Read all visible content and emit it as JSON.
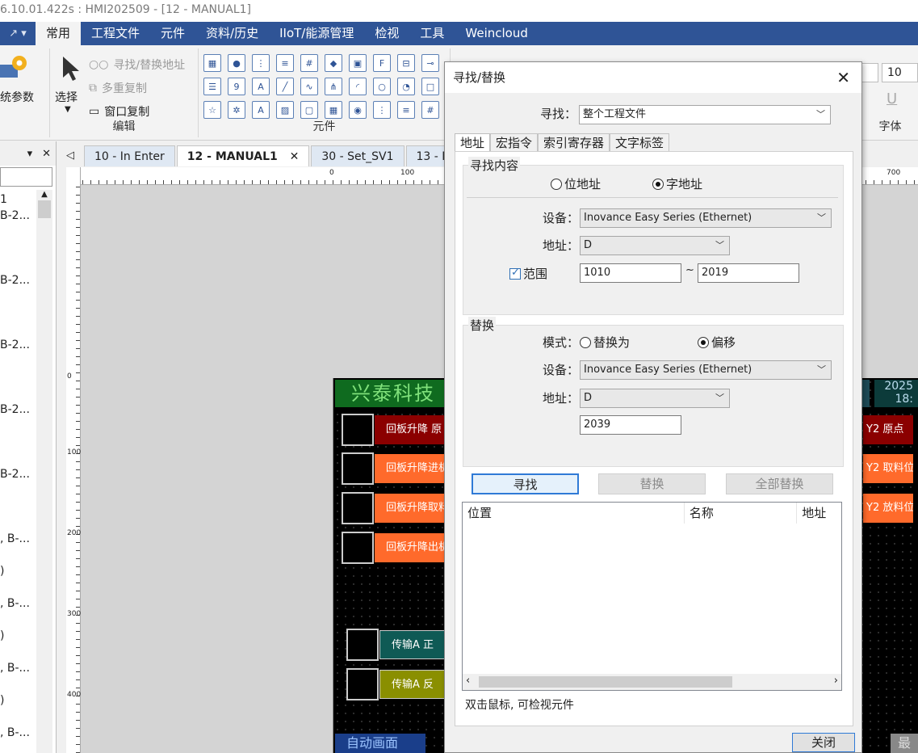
{
  "window": {
    "title": "6.10.01.422s : HMI202509 - [12 - MANUAL1]"
  },
  "ribbon": {
    "quick_access": "↗ ▾",
    "tabs": [
      "常用",
      "工程文件",
      "元件",
      "资料/历史",
      "IIoT/能源管理",
      "检视",
      "工具",
      "Weincloud"
    ],
    "active_tab": 0,
    "system_params_label": "统参数",
    "select_label": "选择",
    "edit_items": [
      "寻找/替换地址",
      "多重复制",
      "窗口复制"
    ],
    "edit_group_label": "编辑",
    "element_group_label": "元件",
    "font_size": "10",
    "font_group_label": "字体"
  },
  "left_panel": {
    "header_icons": [
      "▾",
      "✕"
    ],
    "items": [
      "1",
      "B-2...",
      "B-2...",
      "B-2...",
      "B-2...",
      "B-2...",
      ", B-...",
      ")",
      ", B-...",
      ")",
      ", B-...",
      ")",
      ", B-..."
    ]
  },
  "doc_tabs": {
    "items": [
      {
        "label": "10 - In Enter",
        "active": false
      },
      {
        "label": "12 - MANUAL1",
        "active": true
      },
      {
        "label": "30 - Set_SV1",
        "active": false
      },
      {
        "label": "13 - M",
        "active": false
      }
    ],
    "close_glyph": "✕"
  },
  "rulers": {
    "h_labels": [
      "0",
      "100",
      "700"
    ],
    "v_labels": [
      "0",
      "100",
      "200",
      "300",
      "400"
    ]
  },
  "hmi": {
    "title": "兴泰科技",
    "clock_lines": [
      "2025",
      "18:"
    ],
    "left_buttons": [
      {
        "label": "回板升降 原",
        "color": "#8b0000"
      },
      {
        "label": "回板升降进机",
        "color": "#ff6a2b"
      },
      {
        "label": "回板升降取料",
        "color": "#ff6a2b"
      },
      {
        "label": "回板升降出机",
        "color": "#ff6a2b"
      },
      {
        "label": "传输A 正",
        "color": "#0f5a55"
      },
      {
        "label": "传输A 反",
        "color": "#8a8f00"
      }
    ],
    "right_buttons": [
      {
        "label": "Y2 原点",
        "color": "#8b0000"
      },
      {
        "label": "Y2 取料位",
        "color": "#ff6a2b"
      },
      {
        "label": "Y2 放料位",
        "color": "#ff6a2b"
      }
    ],
    "bottom_left": "自动画面",
    "bottom_right": "最"
  },
  "dialog": {
    "title": "寻找/替换",
    "close_glyph": "✕",
    "find_scope_label": "寻找：",
    "find_scope_value": "整个工程文件",
    "tabs": [
      "地址",
      "宏指令",
      "索引寄存器",
      "文字标签"
    ],
    "active_tab": 0,
    "find": {
      "group_label": "寻找内容",
      "bit_label": "位地址",
      "word_label": "字地址",
      "selected": "word",
      "device_label": "设备：",
      "device_value": "Inovance Easy Series (Ethernet)",
      "address_label": "地址：",
      "address_value": "D",
      "range_label": "范围",
      "range_checked": true,
      "range_from": "1010",
      "range_sep": "~",
      "range_to": "2019"
    },
    "replace": {
      "group_label": "替换",
      "mode_label": "模式：",
      "replace_with_label": "替换为",
      "offset_label": "偏移",
      "selected": "offset",
      "device_label": "设备：",
      "device_value": "Inovance Easy Series (Ethernet)",
      "address_label": "地址：",
      "address_value": "D",
      "offset_value": "2039"
    },
    "buttons": {
      "find": "寻找",
      "replace": "替换",
      "replace_all": "全部替换",
      "close": "关闭"
    },
    "results_columns": [
      "位置",
      "名称",
      "地址"
    ],
    "hint": "双击鼠标, 可检视元件"
  }
}
